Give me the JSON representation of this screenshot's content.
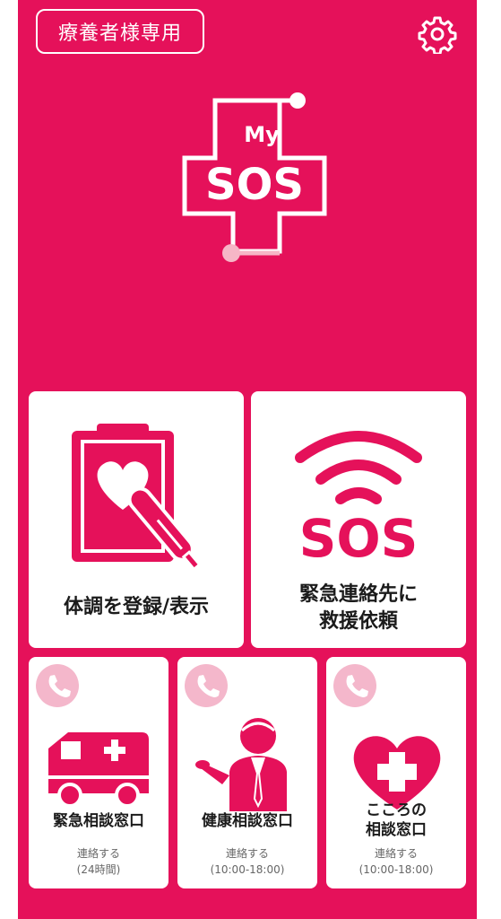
{
  "header": {
    "badge_label": "療養者様専用",
    "settings_icon": "gear-icon"
  },
  "logo": {
    "line1": "My",
    "line2": "SOS"
  },
  "cards": {
    "health": {
      "label": "体調を登録/表示",
      "icon": "clipboard-heart-thermometer-icon"
    },
    "emergency": {
      "sos_text": "SOS",
      "label_line1": "緊急連絡先に",
      "label_line2": "救援依頼",
      "icon": "sos-signal-icon"
    }
  },
  "consult": [
    {
      "title": "緊急相談窓口",
      "sub_line1": "連絡する",
      "sub_line2": "(24時間)",
      "icon": "ambulance-icon"
    },
    {
      "title": "健康相談窓口",
      "sub_line1": "連絡する",
      "sub_line2": "(10:00-18:00)",
      "icon": "doctor-icon"
    },
    {
      "title_line1": "こころの",
      "title_line2": "相談窓口",
      "sub_line1": "連絡する",
      "sub_line2": "(10:00-18:00)",
      "icon": "heart-cross-icon"
    }
  ],
  "colors": {
    "primary": "#e5115a",
    "light_pink": "#f4b7cb",
    "card_bg": "#ffffff",
    "text": "#1b1b1b"
  }
}
